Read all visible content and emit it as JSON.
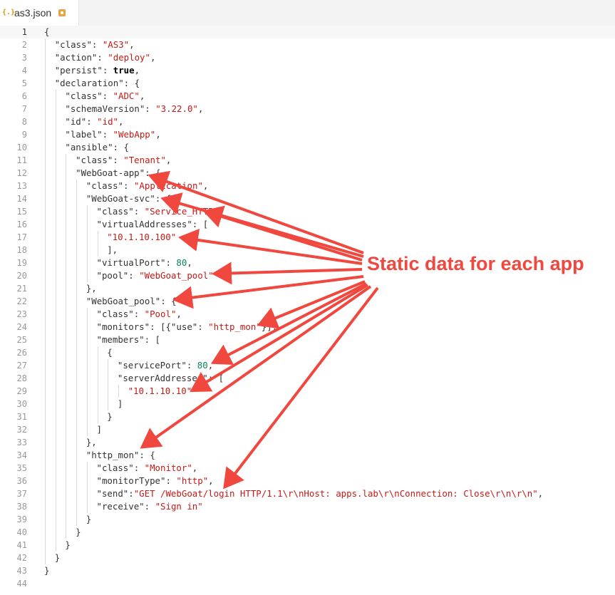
{
  "tab": {
    "title": "as3.json",
    "icon": "json-braces-icon",
    "modified_icon": "unsaved-dot-icon"
  },
  "annotation": {
    "text": "Static data for each app",
    "color": "#f0473e"
  },
  "lines": [
    {
      "n": "1",
      "indent": 0,
      "parts": [
        [
          "k",
          "{"
        ]
      ]
    },
    {
      "n": "2",
      "indent": 1,
      "parts": [
        [
          "k",
          "\"class\": "
        ],
        [
          "s",
          "\"AS3\""
        ],
        [
          "k",
          ","
        ]
      ]
    },
    {
      "n": "3",
      "indent": 1,
      "parts": [
        [
          "k",
          "\"action\": "
        ],
        [
          "s",
          "\"deploy\""
        ],
        [
          "k",
          ","
        ]
      ]
    },
    {
      "n": "4",
      "indent": 1,
      "parts": [
        [
          "k",
          "\"persist\": "
        ],
        [
          "b",
          "true"
        ],
        [
          "k",
          ","
        ]
      ]
    },
    {
      "n": "5",
      "indent": 1,
      "parts": [
        [
          "k",
          "\"declaration\": {"
        ]
      ]
    },
    {
      "n": "6",
      "indent": 2,
      "parts": [
        [
          "k",
          "\"class\": "
        ],
        [
          "s",
          "\"ADC\""
        ],
        [
          "k",
          ","
        ]
      ]
    },
    {
      "n": "7",
      "indent": 2,
      "parts": [
        [
          "k",
          "\"schemaVersion\": "
        ],
        [
          "s",
          "\"3.22.0\""
        ],
        [
          "k",
          ","
        ]
      ]
    },
    {
      "n": "8",
      "indent": 2,
      "parts": [
        [
          "k",
          "\"id\": "
        ],
        [
          "s",
          "\"id\""
        ],
        [
          "k",
          ","
        ]
      ]
    },
    {
      "n": "9",
      "indent": 2,
      "parts": [
        [
          "k",
          "\"label\": "
        ],
        [
          "s",
          "\"WebApp\""
        ],
        [
          "k",
          ","
        ]
      ]
    },
    {
      "n": "10",
      "indent": 2,
      "parts": [
        [
          "k",
          "\"ansible\": {"
        ]
      ]
    },
    {
      "n": "11",
      "indent": 3,
      "parts": [
        [
          "k",
          "\"class\": "
        ],
        [
          "s",
          "\"Tenant\""
        ],
        [
          "k",
          ","
        ]
      ]
    },
    {
      "n": "12",
      "indent": 3,
      "parts": [
        [
          "k",
          "\"WebGoat-app\": {"
        ]
      ]
    },
    {
      "n": "13",
      "indent": 4,
      "parts": [
        [
          "k",
          "\"class\": "
        ],
        [
          "s",
          "\"Application\""
        ],
        [
          "k",
          ","
        ]
      ]
    },
    {
      "n": "14",
      "indent": 4,
      "parts": [
        [
          "k",
          "\"WebGoat-svc\": {"
        ]
      ]
    },
    {
      "n": "15",
      "indent": 5,
      "parts": [
        [
          "k",
          "\"class\": "
        ],
        [
          "s",
          "\"Service_HTTP\""
        ],
        [
          "k",
          ","
        ]
      ]
    },
    {
      "n": "16",
      "indent": 5,
      "parts": [
        [
          "k",
          "\"virtualAddresses\": ["
        ]
      ]
    },
    {
      "n": "17",
      "indent": 6,
      "parts": [
        [
          "s",
          "\"10.1.10.100\""
        ]
      ]
    },
    {
      "n": "18",
      "indent": 6,
      "parts": [
        [
          "k",
          "],"
        ]
      ]
    },
    {
      "n": "19",
      "indent": 5,
      "parts": [
        [
          "k",
          "\"virtualPort\": "
        ],
        [
          "n",
          "80"
        ],
        [
          "k",
          ","
        ]
      ]
    },
    {
      "n": "20",
      "indent": 5,
      "parts": [
        [
          "k",
          "\"pool\": "
        ],
        [
          "s",
          "\"WebGoat_pool\""
        ]
      ]
    },
    {
      "n": "21",
      "indent": 4,
      "parts": [
        [
          "k",
          "},"
        ]
      ]
    },
    {
      "n": "22",
      "indent": 4,
      "parts": [
        [
          "k",
          "\"WebGoat_pool\": {"
        ]
      ]
    },
    {
      "n": "23",
      "indent": 5,
      "parts": [
        [
          "k",
          "\"class\": "
        ],
        [
          "s",
          "\"Pool\""
        ],
        [
          "k",
          ","
        ]
      ]
    },
    {
      "n": "24",
      "indent": 5,
      "parts": [
        [
          "k",
          "\"monitors\": [{\"use\": "
        ],
        [
          "s",
          "\"http_mon\""
        ],
        [
          "k",
          "}],"
        ]
      ]
    },
    {
      "n": "25",
      "indent": 5,
      "parts": [
        [
          "k",
          "\"members\": ["
        ]
      ]
    },
    {
      "n": "26",
      "indent": 6,
      "parts": [
        [
          "k",
          "{"
        ]
      ]
    },
    {
      "n": "27",
      "indent": 7,
      "parts": [
        [
          "k",
          "\"servicePort\": "
        ],
        [
          "n",
          "80"
        ],
        [
          "k",
          ","
        ]
      ]
    },
    {
      "n": "28",
      "indent": 7,
      "parts": [
        [
          "k",
          "\"serverAddresses\": ["
        ]
      ]
    },
    {
      "n": "29",
      "indent": 8,
      "parts": [
        [
          "s",
          "\"10.1.10.10\""
        ]
      ]
    },
    {
      "n": "30",
      "indent": 7,
      "parts": [
        [
          "k",
          "]"
        ]
      ]
    },
    {
      "n": "31",
      "indent": 6,
      "parts": [
        [
          "k",
          "}"
        ]
      ]
    },
    {
      "n": "32",
      "indent": 5,
      "parts": [
        [
          "k",
          "]"
        ]
      ]
    },
    {
      "n": "33",
      "indent": 4,
      "parts": [
        [
          "k",
          "},"
        ]
      ]
    },
    {
      "n": "34",
      "indent": 4,
      "parts": [
        [
          "k",
          "\"http_mon\": {"
        ]
      ]
    },
    {
      "n": "35",
      "indent": 5,
      "parts": [
        [
          "k",
          "\"class\": "
        ],
        [
          "s",
          "\"Monitor\""
        ],
        [
          "k",
          ","
        ]
      ]
    },
    {
      "n": "36",
      "indent": 5,
      "parts": [
        [
          "k",
          "\"monitorType\": "
        ],
        [
          "s",
          "\"http\""
        ],
        [
          "k",
          ","
        ]
      ]
    },
    {
      "n": "37",
      "indent": 5,
      "parts": [
        [
          "k",
          "\"send\":"
        ],
        [
          "s",
          "\"GET /WebGoat/login HTTP/1.1\\r\\nHost: apps.lab\\r\\nConnection: Close\\r\\n\\r\\n\""
        ],
        [
          "k",
          ","
        ]
      ]
    },
    {
      "n": "38",
      "indent": 5,
      "parts": [
        [
          "k",
          "\"receive\": "
        ],
        [
          "s",
          "\"Sign in\""
        ]
      ]
    },
    {
      "n": "39",
      "indent": 4,
      "parts": [
        [
          "k",
          "}"
        ]
      ]
    },
    {
      "n": "40",
      "indent": 3,
      "parts": [
        [
          "k",
          "}"
        ]
      ]
    },
    {
      "n": "41",
      "indent": 2,
      "parts": [
        [
          "k",
          "}"
        ]
      ]
    },
    {
      "n": "42",
      "indent": 1,
      "parts": [
        [
          "k",
          "}"
        ]
      ]
    },
    {
      "n": "43",
      "indent": 0,
      "parts": [
        [
          "k",
          "}"
        ]
      ]
    },
    {
      "n": "44",
      "indent": 0,
      "parts": []
    }
  ],
  "active_line": "1"
}
